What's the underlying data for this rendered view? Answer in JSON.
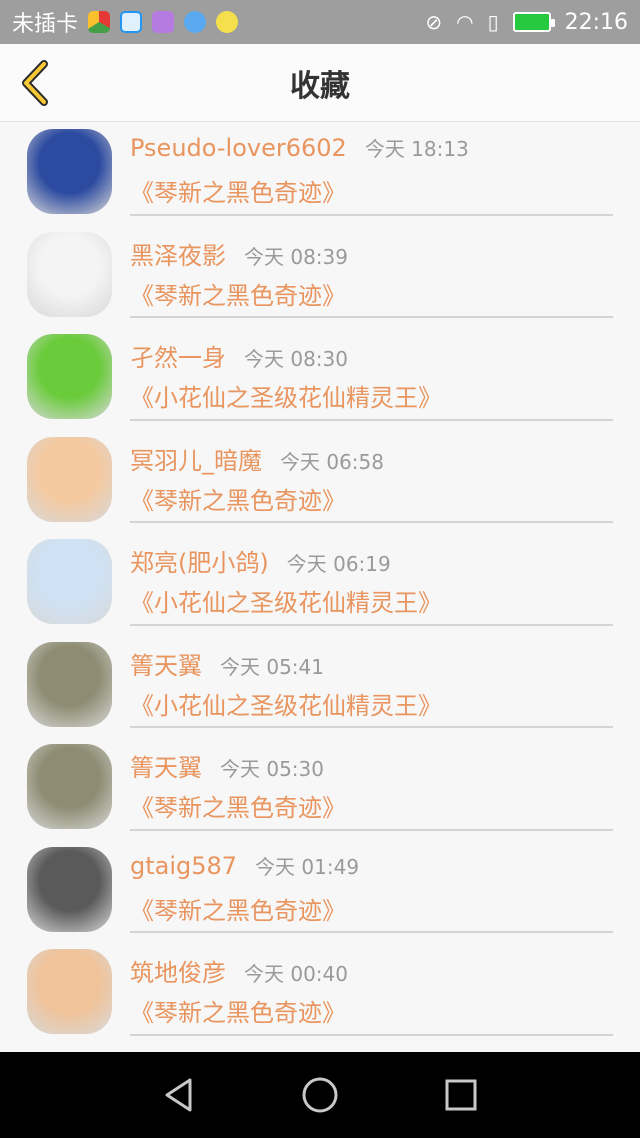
{
  "status_bar": {
    "carrier": "未插卡",
    "time": "22:16",
    "app_icons": [
      "chrome-icon",
      "browser-icon",
      "gallery-icon",
      "info-icon",
      "qq-icon"
    ]
  },
  "header": {
    "back_icon": "chevron-left-icon",
    "title": "收藏"
  },
  "items": [
    {
      "name": "Pseudo-lover6602",
      "time": "今天 18:13",
      "book": "《琴新之黑色奇迹》",
      "avatar_color": "#2b4aa0"
    },
    {
      "name": "黑泽夜影",
      "time": "今天 08:39",
      "book": "《琴新之黑色奇迹》",
      "avatar_color": "#f4f4f4"
    },
    {
      "name": "孑然一身",
      "time": "今天 08:30",
      "book": "《小花仙之圣级花仙精灵王》",
      "avatar_color": "#6acb3b"
    },
    {
      "name": "冥羽儿_暗魔",
      "time": "今天 06:58",
      "book": "《琴新之黑色奇迹》",
      "avatar_color": "#f4c9a0"
    },
    {
      "name": "郑亮(肥小鸽)",
      "time": "今天 06:19",
      "book": "《小花仙之圣级花仙精灵王》",
      "avatar_color": "#cfe2f5"
    },
    {
      "name": "箐天翼",
      "time": "今天 05:41",
      "book": "《小花仙之圣级花仙精灵王》",
      "avatar_color": "#8e8d73"
    },
    {
      "name": "箐天翼",
      "time": "今天 05:30",
      "book": "《琴新之黑色奇迹》",
      "avatar_color": "#8e8d73"
    },
    {
      "name": "gtaig587",
      "time": "今天 01:49",
      "book": "《琴新之黑色奇迹》",
      "avatar_color": "#5a5a5a"
    },
    {
      "name": "筑地俊彦",
      "time": "今天 00:40",
      "book": "《琴新之黑色奇迹》",
      "avatar_color": "#f0c39a"
    }
  ],
  "nav": {
    "back": "triangle-back-icon",
    "home": "circle-home-icon",
    "recents": "square-recents-icon"
  }
}
